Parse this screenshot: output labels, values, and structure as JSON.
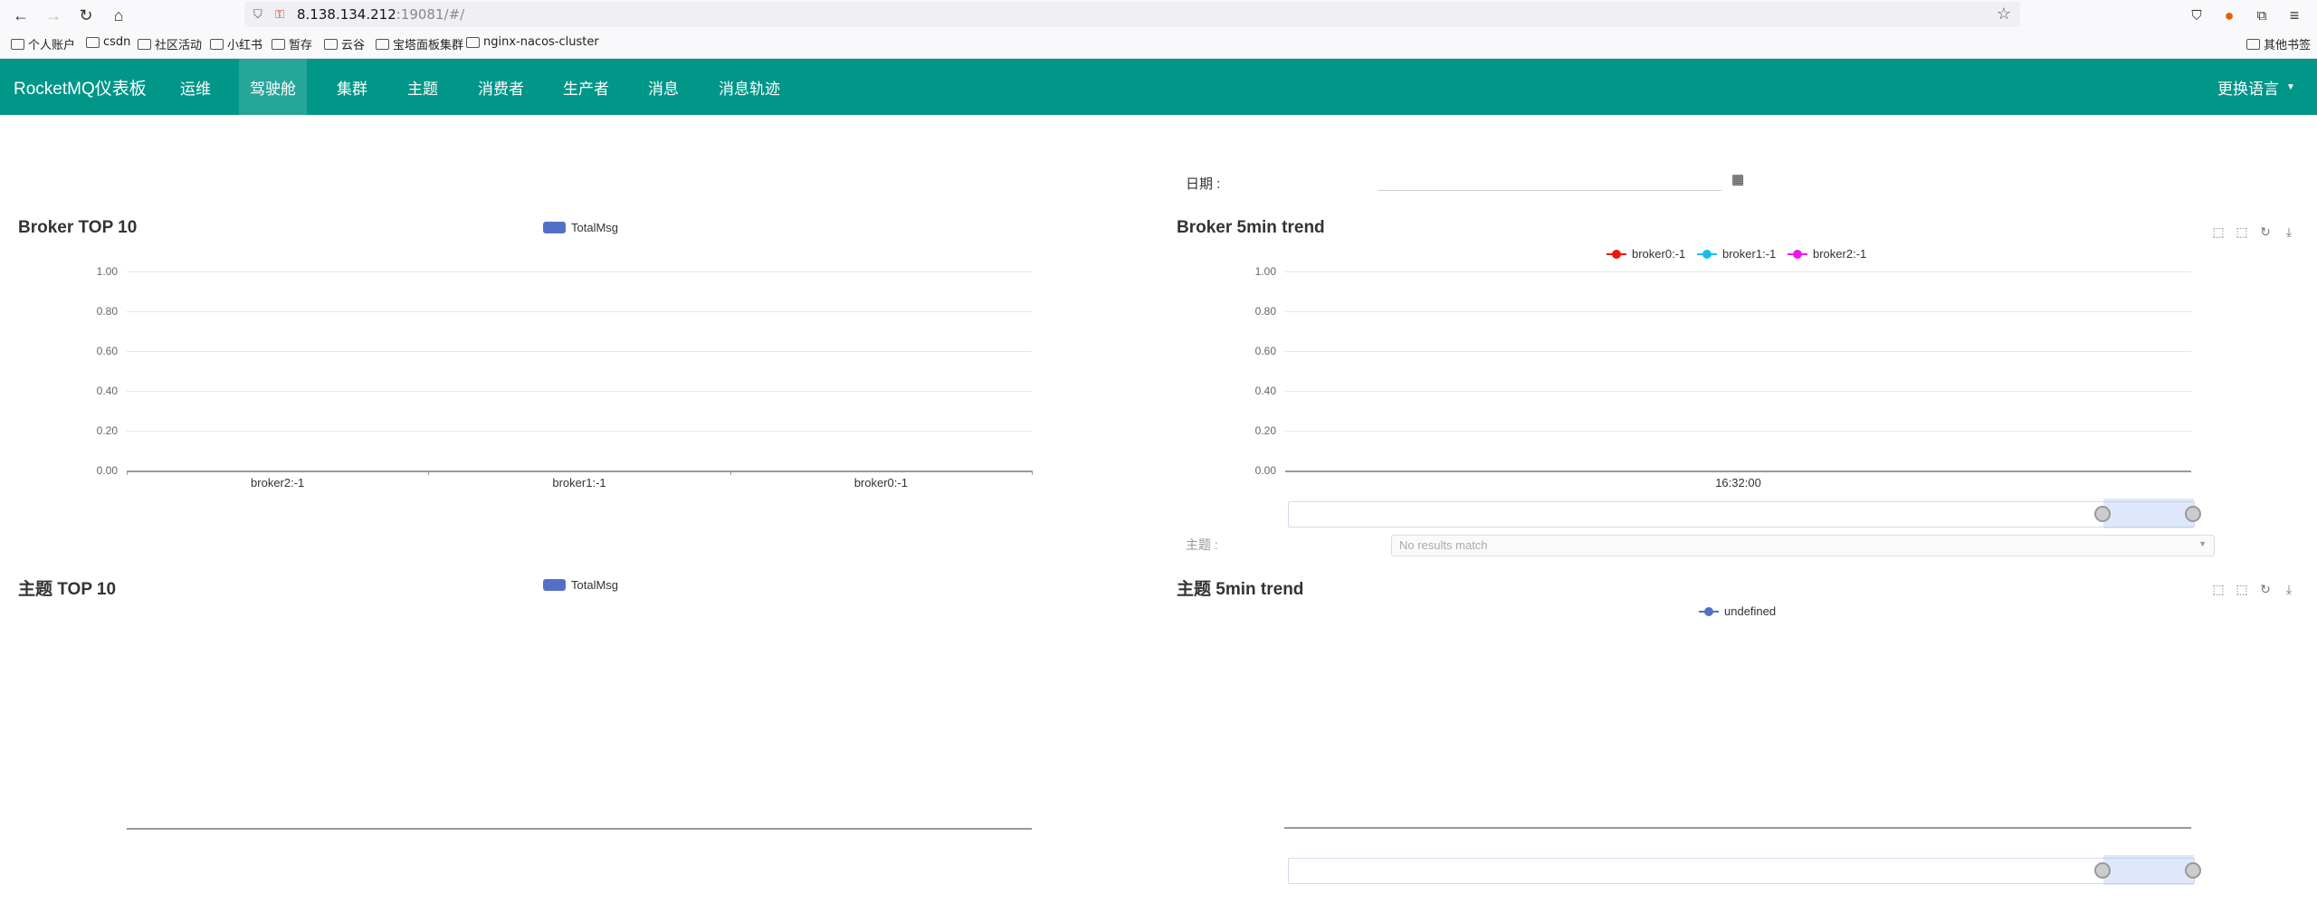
{
  "browser": {
    "url_host": "8.138.134.212",
    "url_rest": ":19081/#/",
    "bookmarks": [
      "个人账户",
      "csdn",
      "社区活动",
      "小红书",
      "暂存",
      "云谷",
      "宝塔面板集群",
      "nginx-nacos-cluster"
    ],
    "other_bookmarks": "其他书签"
  },
  "app": {
    "brand": "RocketMQ仪表板",
    "nav": [
      "运维",
      "驾驶舱",
      "集群",
      "主题",
      "消费者",
      "生产者",
      "消息",
      "消息轨迹"
    ],
    "active_nav": "驾驶舱",
    "language": "更换语言"
  },
  "filters": {
    "date_label": "日期 :",
    "topic_label": "主题 :",
    "topic_placeholder": "No results match"
  },
  "chart_data": [
    {
      "type": "bar",
      "title": "Broker TOP 10",
      "legend": [
        "TotalMsg"
      ],
      "categories": [
        "broker2:-1",
        "broker1:-1",
        "broker0:-1"
      ],
      "series": [
        {
          "name": "TotalMsg",
          "values": [
            0,
            0,
            0
          ]
        }
      ],
      "y_ticks": [
        "1.00",
        "0.80",
        "0.60",
        "0.40",
        "0.20",
        "0.00"
      ],
      "ylim": [
        0,
        1
      ],
      "grid": true
    },
    {
      "type": "line",
      "title": "Broker 5min trend",
      "legend": [
        "broker0:-1",
        "broker1:-1",
        "broker2:-1"
      ],
      "colors": [
        "#e8180c",
        "#15bfe6",
        "#f217e8"
      ],
      "x": [
        "16:32:00"
      ],
      "series": [
        {
          "name": "broker0:-1",
          "values": [
            0
          ]
        },
        {
          "name": "broker1:-1",
          "values": [
            0
          ]
        },
        {
          "name": "broker2:-1",
          "values": [
            0
          ]
        }
      ],
      "y_ticks": [
        "1.00",
        "0.80",
        "0.60",
        "0.40",
        "0.20",
        "0.00"
      ],
      "ylim": [
        0,
        1
      ],
      "grid": true
    },
    {
      "type": "bar",
      "title": "主题 TOP 10",
      "legend": [
        "TotalMsg"
      ],
      "categories": [],
      "series": [
        {
          "name": "TotalMsg",
          "values": []
        }
      ]
    },
    {
      "type": "line",
      "title": "主题 5min trend",
      "legend": [
        "undefined"
      ],
      "colors": [
        "#5470c6"
      ],
      "x": [],
      "series": [
        {
          "name": "undefined",
          "values": []
        }
      ]
    }
  ]
}
